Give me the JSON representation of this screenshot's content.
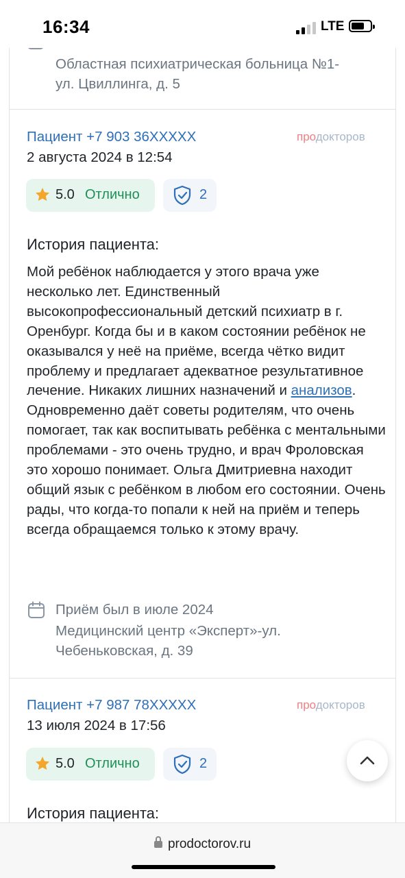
{
  "status_bar": {
    "time": "16:34",
    "network": "LTE"
  },
  "top_location": {
    "lines": [
      "Областная психиатрическая больница №1-",
      "ул. Цвиллинга, д. 5"
    ]
  },
  "reviews": [
    {
      "patient": "Пациент +7 903 36XXXXX",
      "brand_pro": "про",
      "brand_doc": "докторов",
      "date": "2 августа 2024 в 12:54",
      "score": "5.0",
      "score_label": "Отлично",
      "verified_count": "2",
      "story_title": "История пациента:",
      "story_before": "Мой ребёнок наблюдается у этого врача уже несколько лет. Единственный высокопрофессиональный детский психиатр в г. Оренбург. Когда бы и в каком состоянии ребёнок не оказывался у неё на приёме, всегда чётко видит проблему и предлагает адекватное результативное лечение. Никаких лишних назначений и ",
      "story_link": "анализов",
      "story_after": ". Одновременно даёт советы родителям, что очень помогает, так как воспитывать ребёнка с ментальными проблемами - это очень трудно, и врач Фроловская это хорошо понимает. Ольга Дмитриевна находит общий язык с ребёнком в любом его состоянии. Очень рады, что когда-то попали к ней на приём и теперь всегда обращаемся только к этому врачу.",
      "visit": "Приём был в июле 2024",
      "clinic_line1": "Медицинский центр «Эксперт»-ул.",
      "clinic_line2": "Чебеньковская, д. 39"
    },
    {
      "patient": "Пациент +7 987 78XXXXX",
      "brand_pro": "про",
      "brand_doc": "докторов",
      "date": "13 июля 2024 в 17:56",
      "score": "5.0",
      "score_label": "Отлично",
      "verified_count": "2",
      "story_title": "История пациента:"
    }
  ],
  "browser": {
    "url": "prodoctorov.ru"
  },
  "colors": {
    "link": "#2d6fb8",
    "rating_bg": "#e6f6ee",
    "rating_label": "#1d8f57",
    "brand_pro": "#f07e83",
    "brand_doc": "#a8b7c8"
  }
}
